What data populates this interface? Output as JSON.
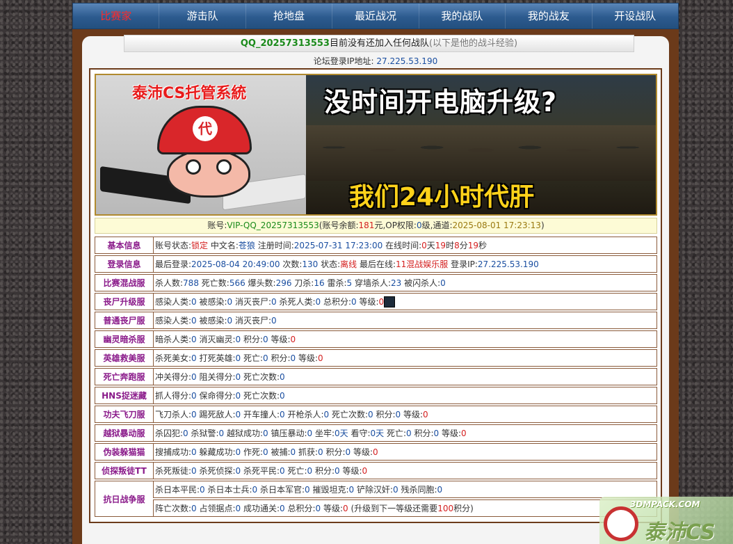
{
  "nav": {
    "items": [
      "比赛家",
      "游击队",
      "抢地盘",
      "最近战况",
      "我的战队",
      "我的战友",
      "开设战队"
    ],
    "active_index": 0
  },
  "infobar": {
    "qq": "QQ_20257313553",
    "message": "目前没有还加入任何战队",
    "sub": "(以下是他的战斗经验)"
  },
  "ip_line": {
    "label": "论坛登录IP地址:",
    "ip": "27.225.53.190"
  },
  "banner": {
    "left_title": "泰沛CS托管系統",
    "hat_badge": "代",
    "headline": "没时间开电脑升级?",
    "footline": "我们24小时代肝"
  },
  "account": {
    "label": "账号:",
    "id": "VIP-QQ_20257313553",
    "balance_prefix": "(账号余额:",
    "balance": "181",
    "balance_unit": "元,OP权限:",
    "op_level": "0",
    "op_unit": "级,通道:",
    "channel_time": "2025-08-01 17:23:13",
    "close": ")"
  },
  "rows": [
    {
      "label": "基本信息",
      "parts": [
        {
          "t": "账号状态:"
        },
        {
          "t": "锁定",
          "c": "r"
        },
        {
          "t": " 中文名:"
        },
        {
          "t": "苍狼",
          "c": "n"
        },
        {
          "t": " 注册时间:"
        },
        {
          "t": "2025-07-31 17:23:00",
          "c": "n"
        },
        {
          "t": " 在线时间:"
        },
        {
          "t": "0",
          "c": "r"
        },
        {
          "t": "天"
        },
        {
          "t": "19",
          "c": "r"
        },
        {
          "t": "时"
        },
        {
          "t": "8",
          "c": "r"
        },
        {
          "t": "分"
        },
        {
          "t": "19",
          "c": "r"
        },
        {
          "t": "秒"
        }
      ]
    },
    {
      "label": "登录信息",
      "parts": [
        {
          "t": "最后登录:"
        },
        {
          "t": "2025-08-04 20:49:00",
          "c": "n"
        },
        {
          "t": " 次数:"
        },
        {
          "t": "130",
          "c": "n"
        },
        {
          "t": " 状态:"
        },
        {
          "t": "离线",
          "c": "r"
        },
        {
          "t": " 最后在线:"
        },
        {
          "t": "11混战娱乐服",
          "c": "r"
        },
        {
          "t": " 登录IP:"
        },
        {
          "t": "27.225.53.190",
          "c": "n"
        }
      ]
    },
    {
      "label": "比赛混战服",
      "parts": [
        {
          "t": "杀人数:"
        },
        {
          "t": "788",
          "c": "n"
        },
        {
          "t": " 死亡数:"
        },
        {
          "t": "566",
          "c": "n"
        },
        {
          "t": " 爆头数:"
        },
        {
          "t": "296",
          "c": "n"
        },
        {
          "t": " 刀杀:"
        },
        {
          "t": "16",
          "c": "n"
        },
        {
          "t": " 雷杀:"
        },
        {
          "t": "5",
          "c": "n"
        },
        {
          "t": " 穿墙杀人:"
        },
        {
          "t": "23",
          "c": "n"
        },
        {
          "t": " 被闪杀人:"
        },
        {
          "t": "0",
          "c": "n"
        }
      ]
    },
    {
      "label": "丧尸升级服",
      "avatar": true,
      "parts": [
        {
          "t": "感染人类:"
        },
        {
          "t": "0",
          "c": "n"
        },
        {
          "t": " 被感染:"
        },
        {
          "t": "0",
          "c": "n"
        },
        {
          "t": " 消灭丧尸:"
        },
        {
          "t": "0",
          "c": "n"
        },
        {
          "t": " 杀死人类:"
        },
        {
          "t": "0",
          "c": "n"
        },
        {
          "t": " 总积分:"
        },
        {
          "t": "0",
          "c": "n"
        },
        {
          "t": " 等级:"
        },
        {
          "t": "0",
          "c": "r"
        }
      ]
    },
    {
      "label": "普通丧尸服",
      "parts": [
        {
          "t": "感染人类:"
        },
        {
          "t": "0",
          "c": "n"
        },
        {
          "t": " 被感染:"
        },
        {
          "t": "0",
          "c": "n"
        },
        {
          "t": " 消灭丧尸:"
        },
        {
          "t": "0",
          "c": "n"
        }
      ]
    },
    {
      "label": "幽灵暗杀服",
      "parts": [
        {
          "t": "暗杀人类:"
        },
        {
          "t": "0",
          "c": "n"
        },
        {
          "t": " 消灭幽灵:"
        },
        {
          "t": "0",
          "c": "n"
        },
        {
          "t": " 积分:"
        },
        {
          "t": "0",
          "c": "n"
        },
        {
          "t": " 等级:"
        },
        {
          "t": "0",
          "c": "r"
        }
      ]
    },
    {
      "label": "英雄救美服",
      "parts": [
        {
          "t": "杀死美女:"
        },
        {
          "t": "0",
          "c": "n"
        },
        {
          "t": " 打死英雄:"
        },
        {
          "t": "0",
          "c": "n"
        },
        {
          "t": " 死亡:"
        },
        {
          "t": "0",
          "c": "n"
        },
        {
          "t": " 积分:"
        },
        {
          "t": "0",
          "c": "n"
        },
        {
          "t": " 等级:"
        },
        {
          "t": "0",
          "c": "r"
        }
      ]
    },
    {
      "label": "死亡奔跑服",
      "parts": [
        {
          "t": "冲关得分:"
        },
        {
          "t": "0",
          "c": "n"
        },
        {
          "t": " 阻关得分:"
        },
        {
          "t": "0",
          "c": "n"
        },
        {
          "t": " 死亡次数:"
        },
        {
          "t": "0",
          "c": "n"
        }
      ]
    },
    {
      "label": "HNS捉迷藏",
      "parts": [
        {
          "t": "抓人得分:"
        },
        {
          "t": "0",
          "c": "n"
        },
        {
          "t": " 保命得分:"
        },
        {
          "t": "0",
          "c": "n"
        },
        {
          "t": " 死亡次数:"
        },
        {
          "t": "0",
          "c": "n"
        }
      ]
    },
    {
      "label": "功夫飞刀服",
      "parts": [
        {
          "t": "飞刀杀人:"
        },
        {
          "t": "0",
          "c": "n"
        },
        {
          "t": " 踢死敌人:"
        },
        {
          "t": "0",
          "c": "n"
        },
        {
          "t": " 开车撞人:"
        },
        {
          "t": "0",
          "c": "n"
        },
        {
          "t": " 开枪杀人:"
        },
        {
          "t": "0",
          "c": "n"
        },
        {
          "t": " 死亡次数:"
        },
        {
          "t": "0",
          "c": "n"
        },
        {
          "t": " 积分:"
        },
        {
          "t": "0",
          "c": "n"
        },
        {
          "t": " 等级:"
        },
        {
          "t": "0",
          "c": "r"
        }
      ]
    },
    {
      "label": "越狱暴动服",
      "parts": [
        {
          "t": "杀囚犯:"
        },
        {
          "t": "0",
          "c": "n"
        },
        {
          "t": " 杀狱警:"
        },
        {
          "t": "0",
          "c": "n"
        },
        {
          "t": " 越狱成功:"
        },
        {
          "t": "0",
          "c": "n"
        },
        {
          "t": " 镇压暴动:"
        },
        {
          "t": "0",
          "c": "n"
        },
        {
          "t": " 坐牢:"
        },
        {
          "t": "0天",
          "c": "n"
        },
        {
          "t": " 看守:"
        },
        {
          "t": "0天",
          "c": "n"
        },
        {
          "t": " 死亡:"
        },
        {
          "t": "0",
          "c": "n"
        },
        {
          "t": " 积分:"
        },
        {
          "t": "0",
          "c": "n"
        },
        {
          "t": " 等级:"
        },
        {
          "t": "0",
          "c": "r"
        }
      ]
    },
    {
      "label": "伪装躲猫猫",
      "parts": [
        {
          "t": "搜捕成功:"
        },
        {
          "t": "0",
          "c": "n"
        },
        {
          "t": " 躲藏成功:"
        },
        {
          "t": "0",
          "c": "n"
        },
        {
          "t": " 作死:"
        },
        {
          "t": "0",
          "c": "n"
        },
        {
          "t": " 被捕:"
        },
        {
          "t": "0",
          "c": "n"
        },
        {
          "t": " 抓获:"
        },
        {
          "t": "0",
          "c": "n"
        },
        {
          "t": " 积分:"
        },
        {
          "t": "0",
          "c": "n"
        },
        {
          "t": " 等级:"
        },
        {
          "t": "0",
          "c": "r"
        }
      ]
    },
    {
      "label": "侦探叛徒TT",
      "parts": [
        {
          "t": "杀死叛徒:"
        },
        {
          "t": "0",
          "c": "n"
        },
        {
          "t": " 杀死侦探:"
        },
        {
          "t": "0",
          "c": "n"
        },
        {
          "t": " 杀死平民:"
        },
        {
          "t": "0",
          "c": "n"
        },
        {
          "t": " 死亡:"
        },
        {
          "t": "0",
          "c": "n"
        },
        {
          "t": " 积分:"
        },
        {
          "t": "0",
          "c": "n"
        },
        {
          "t": " 等级:"
        },
        {
          "t": "0",
          "c": "r"
        }
      ]
    }
  ],
  "war_row": {
    "label": "抗日战争服",
    "line1": [
      {
        "t": "杀日本平民:"
      },
      {
        "t": "0",
        "c": "n"
      },
      {
        "t": " 杀日本士兵:"
      },
      {
        "t": "0",
        "c": "n"
      },
      {
        "t": " 杀日本军官:"
      },
      {
        "t": "0",
        "c": "n"
      },
      {
        "t": " 摧毁坦克:"
      },
      {
        "t": "0",
        "c": "n"
      },
      {
        "t": " 铲除汉奸:"
      },
      {
        "t": "0",
        "c": "n"
      },
      {
        "t": " 残杀同胞:"
      },
      {
        "t": "0",
        "c": "n"
      }
    ],
    "line2": [
      {
        "t": "阵亡次数:"
      },
      {
        "t": "0",
        "c": "n"
      },
      {
        "t": " 占领据点:"
      },
      {
        "t": "0",
        "c": "n"
      },
      {
        "t": " 成功通关:"
      },
      {
        "t": "0",
        "c": "n"
      },
      {
        "t": " 总积分:"
      },
      {
        "t": "0",
        "c": "n"
      },
      {
        "t": " 等级:"
      },
      {
        "t": "0",
        "c": "r"
      },
      {
        "t": " (升级到下一等级还需要"
      },
      {
        "t": "100",
        "c": "r"
      },
      {
        "t": "积分)"
      }
    ]
  },
  "watermark": {
    "top": "3DMPACK.COM",
    "main": "泰沛CS"
  },
  "colors": {
    "nav_active": "#ff2a2a",
    "label_purple": "#8a1a8a",
    "value_blue": "#1a4ea0",
    "value_red": "#d42020",
    "frame_brown": "#6b3a1a"
  }
}
